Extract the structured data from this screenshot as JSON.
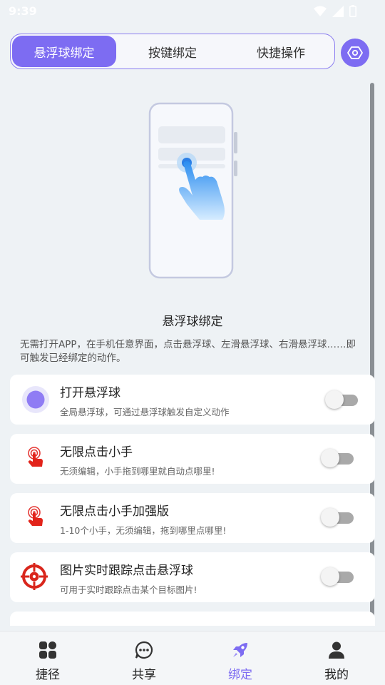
{
  "status_bar": {
    "time": "9:39"
  },
  "tabs": [
    {
      "label": "悬浮球绑定",
      "active": true
    },
    {
      "label": "按键绑定",
      "active": false
    },
    {
      "label": "快捷操作",
      "active": false
    }
  ],
  "section": {
    "title": "悬浮球绑定",
    "description": "无需打开APP，在手机任意界面，点击悬浮球、左滑悬浮球、右滑悬浮球……即可触发已经绑定的动作。"
  },
  "cards": [
    {
      "title": "打开悬浮球",
      "subtitle": "全局悬浮球，可通过悬浮球触发自定义动作",
      "icon": "floating-ball-icon",
      "enabled": false
    },
    {
      "title": "无限点击小手",
      "subtitle": "无须编辑，小手拖到哪里就自动点哪里!",
      "icon": "tapping-hand-icon",
      "enabled": false
    },
    {
      "title": "无限点击小手加强版",
      "subtitle": "1-10个小手，无须编辑，拖到哪里点哪里!",
      "icon": "tapping-hand-plus-icon",
      "enabled": false
    },
    {
      "title": "图片实时跟踪点击悬浮球",
      "subtitle": "可用于实时跟踪点击某个目标图片!",
      "icon": "target-crosshair-icon",
      "enabled": false
    }
  ],
  "bottom_nav": [
    {
      "label": "捷径",
      "icon": "grid-icon",
      "active": false
    },
    {
      "label": "共享",
      "icon": "chat-bubble-icon",
      "active": false
    },
    {
      "label": "绑定",
      "icon": "rocket-icon",
      "active": true
    },
    {
      "label": "我的",
      "icon": "person-icon",
      "active": false
    }
  ],
  "colors": {
    "accent": "#7d6cf2",
    "background": "#eef2f5",
    "card": "#ffffff",
    "target_red": "#d9261c"
  }
}
